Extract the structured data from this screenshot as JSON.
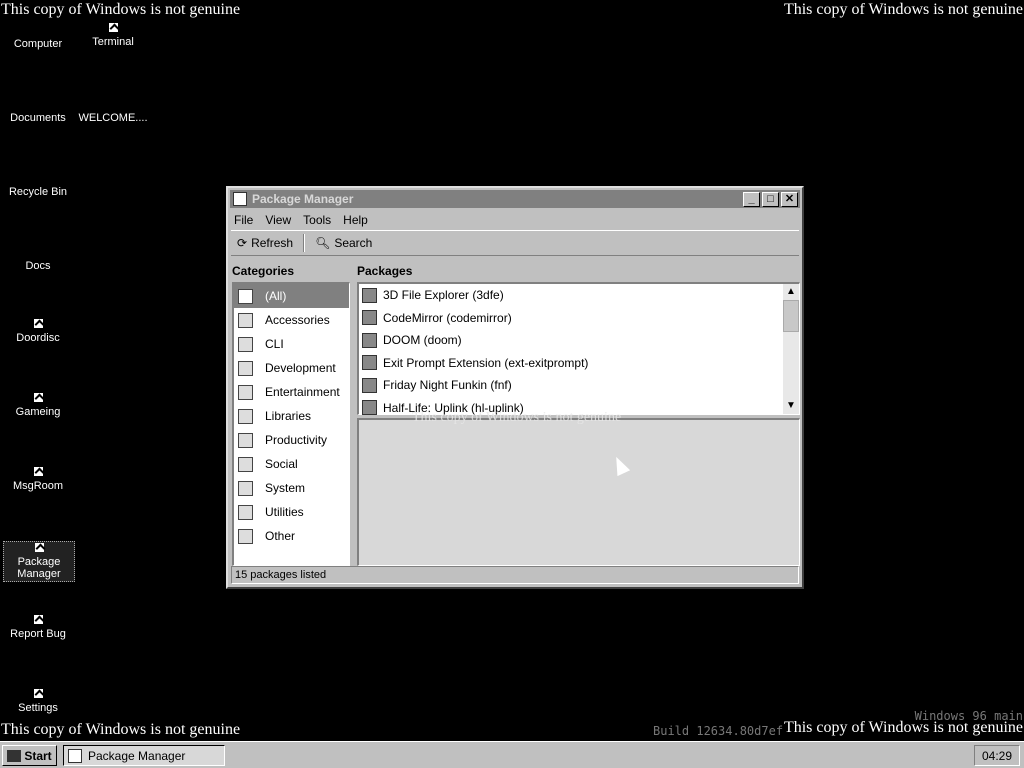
{
  "watermark": "This copy of Windows is not genuine",
  "build": {
    "line1": "Windows 96 main",
    "line2": "Build 12634.80d7ef"
  },
  "desktop": {
    "icons": [
      {
        "label": "Computer",
        "shortcut": false
      },
      {
        "label": "Documents",
        "shortcut": false
      },
      {
        "label": "Recycle Bin",
        "shortcut": false
      },
      {
        "label": "Docs",
        "shortcut": false
      },
      {
        "label": "Doordisc",
        "shortcut": true
      },
      {
        "label": "Gameing",
        "shortcut": true
      },
      {
        "label": "MsgRoom",
        "shortcut": true
      },
      {
        "label": "Package Manager",
        "shortcut": true,
        "selected": true
      },
      {
        "label": "Report Bug",
        "shortcut": true
      },
      {
        "label": "Settings",
        "shortcut": true
      },
      {
        "label": "Terminal",
        "shortcut": true
      },
      {
        "label": "WELCOME....",
        "shortcut": false
      }
    ]
  },
  "window": {
    "title": "Package Manager",
    "menu": [
      "File",
      "View",
      "Tools",
      "Help"
    ],
    "toolbar": {
      "refresh": "Refresh",
      "search": "Search"
    },
    "categories_header": "Categories",
    "packages_header": "Packages",
    "categories": [
      "(All)",
      "Accessories",
      "CLI",
      "Development",
      "Entertainment",
      "Libraries",
      "Productivity",
      "Social",
      "System",
      "Utilities",
      "Other"
    ],
    "packages": [
      "3D File Explorer (3dfe)",
      "CodeMirror (codemirror)",
      "DOOM (doom)",
      "Exit Prompt Extension (ext-exitprompt)",
      "Friday Night Funkin (fnf)",
      "Half-Life: Uplink (hl-uplink)"
    ],
    "status": "15 packages listed"
  },
  "taskbar": {
    "start": "Start",
    "task": "Package Manager",
    "clock": "04:29"
  }
}
